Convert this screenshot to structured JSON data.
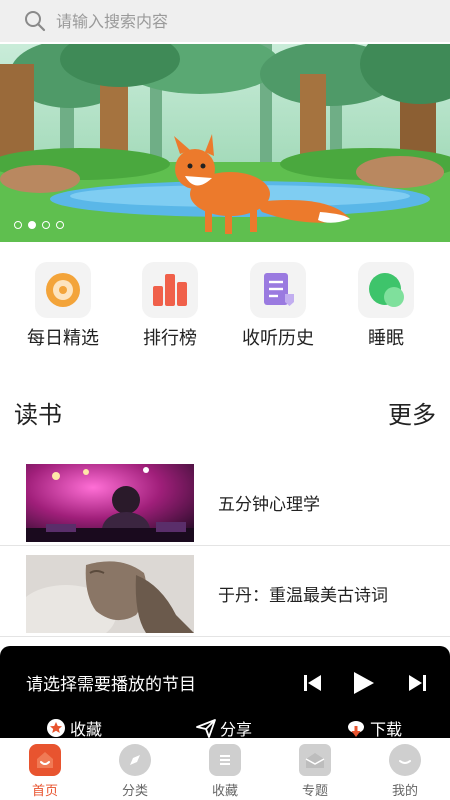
{
  "search": {
    "placeholder": "请输入搜索内容"
  },
  "banner": {
    "dot_count": 4,
    "active_dot": 1
  },
  "quick": [
    {
      "label": "每日精选",
      "icon": "daily-pick-icon",
      "color": "#f3a43a"
    },
    {
      "label": "排行榜",
      "icon": "ranking-icon",
      "color": "#f0604a"
    },
    {
      "label": "收听历史",
      "icon": "history-icon",
      "color": "#9a7ae0"
    },
    {
      "label": "睡眠",
      "icon": "sleep-icon",
      "color": "#3ec46b"
    }
  ],
  "section": {
    "title": "读书",
    "more": "更多"
  },
  "list": [
    {
      "title": "五分钟心理学"
    },
    {
      "title": "于丹：重温最美古诗词"
    }
  ],
  "player": {
    "now_playing": "请选择需要播放的节目",
    "favorite_label": "收藏",
    "share_label": "分享",
    "download_label": "下载"
  },
  "tabbar": [
    {
      "label": "首页",
      "icon": "home-icon",
      "active": true
    },
    {
      "label": "分类",
      "icon": "category-icon",
      "active": false
    },
    {
      "label": "收藏",
      "icon": "favorites-icon",
      "active": false
    },
    {
      "label": "专题",
      "icon": "topics-icon",
      "active": false
    },
    {
      "label": "我的",
      "icon": "profile-icon",
      "active": false
    }
  ],
  "colors": {
    "accent": "#e8542f",
    "tab_inactive": "#cfcfcf"
  }
}
